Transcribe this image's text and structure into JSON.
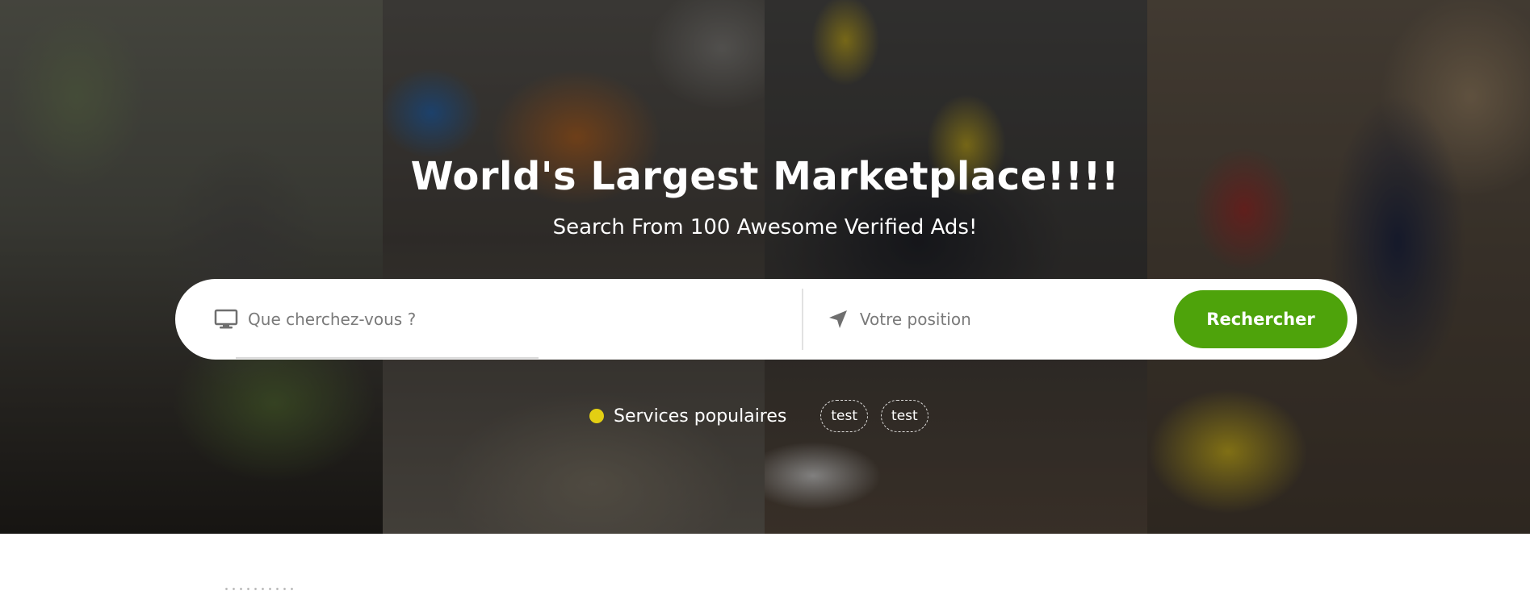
{
  "hero": {
    "title": "World's Largest Marketplace!!!!",
    "subtitle": "Search From 100 Awesome Verified Ads!"
  },
  "search": {
    "what_placeholder": "Que cherchez-vous ?",
    "what_icon": "monitor-icon",
    "where_placeholder": "Votre position",
    "where_icon": "location-arrow-icon",
    "button_label": "Rechercher"
  },
  "popular": {
    "label": "Services populaires",
    "tags": [
      "test",
      "test"
    ]
  },
  "colors": {
    "search_button": "#4ea30b",
    "popular_dot": "#e3cf13"
  }
}
